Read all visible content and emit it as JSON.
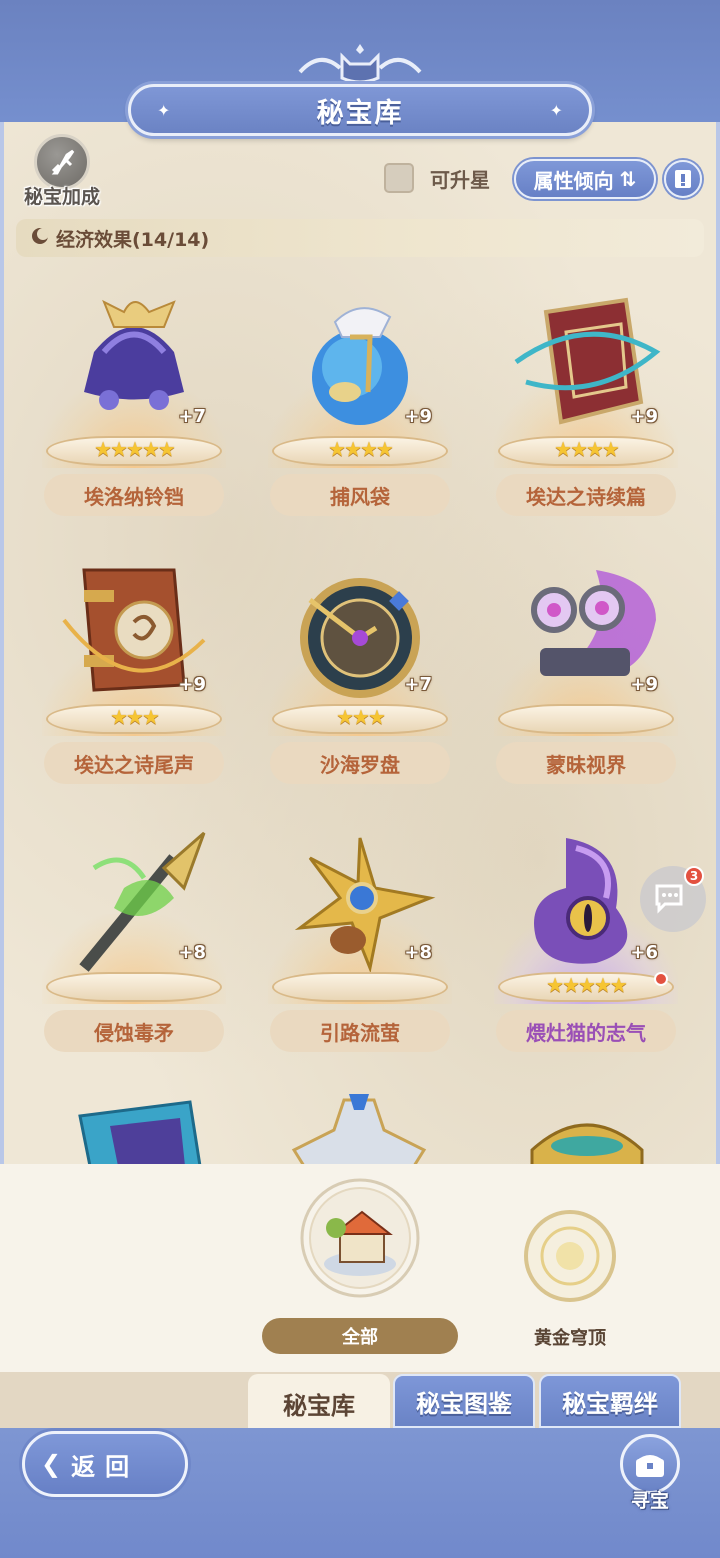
{
  "header": {
    "title": "秘宝库"
  },
  "toolbar": {
    "bonus_label": "秘宝加成",
    "upgradable_label": "可升星",
    "attr_sort_label": "属性倾向"
  },
  "effect_bar": {
    "label": "经济效果(14/14)"
  },
  "items": [
    {
      "name": "埃洛纳铃铛",
      "level": "+7",
      "stars": "★★★★★",
      "rarity": "gold"
    },
    {
      "name": "捕风袋",
      "level": "+9",
      "stars": "★★★★",
      "rarity": "gold"
    },
    {
      "name": "埃达之诗续篇",
      "level": "+9",
      "stars": "★★★★",
      "rarity": "gold"
    },
    {
      "name": "埃达之诗尾声",
      "level": "+9",
      "stars": "★★★",
      "rarity": "gold"
    },
    {
      "name": "沙海罗盘",
      "level": "+7",
      "stars": "★★★",
      "rarity": "gold"
    },
    {
      "name": "蒙昧视界",
      "level": "+9",
      "stars": "",
      "rarity": "gold"
    },
    {
      "name": "侵蚀毒矛",
      "level": "+8",
      "stars": "",
      "rarity": "gold"
    },
    {
      "name": "引路流萤",
      "level": "+8",
      "stars": "",
      "rarity": "gold"
    },
    {
      "name": "煨灶猫的志气",
      "level": "+6",
      "stars": "★★★★★",
      "rarity": "purple"
    }
  ],
  "chat": {
    "badge_count": "3"
  },
  "filters": {
    "all_label": "全部",
    "gold_label": "黄金穹顶"
  },
  "tabs": [
    {
      "label": "秘宝库"
    },
    {
      "label": "秘宝图鉴"
    },
    {
      "label": "秘宝羁绊"
    }
  ],
  "bottom": {
    "back_label": "返回",
    "seek_label": "寻宝"
  },
  "colors": {
    "accent_blue": "#6f86c4",
    "parchment": "#efe7d6",
    "name_text": "#b5643a",
    "purple_name": "#9a4fb6",
    "star": "#f6c533"
  }
}
